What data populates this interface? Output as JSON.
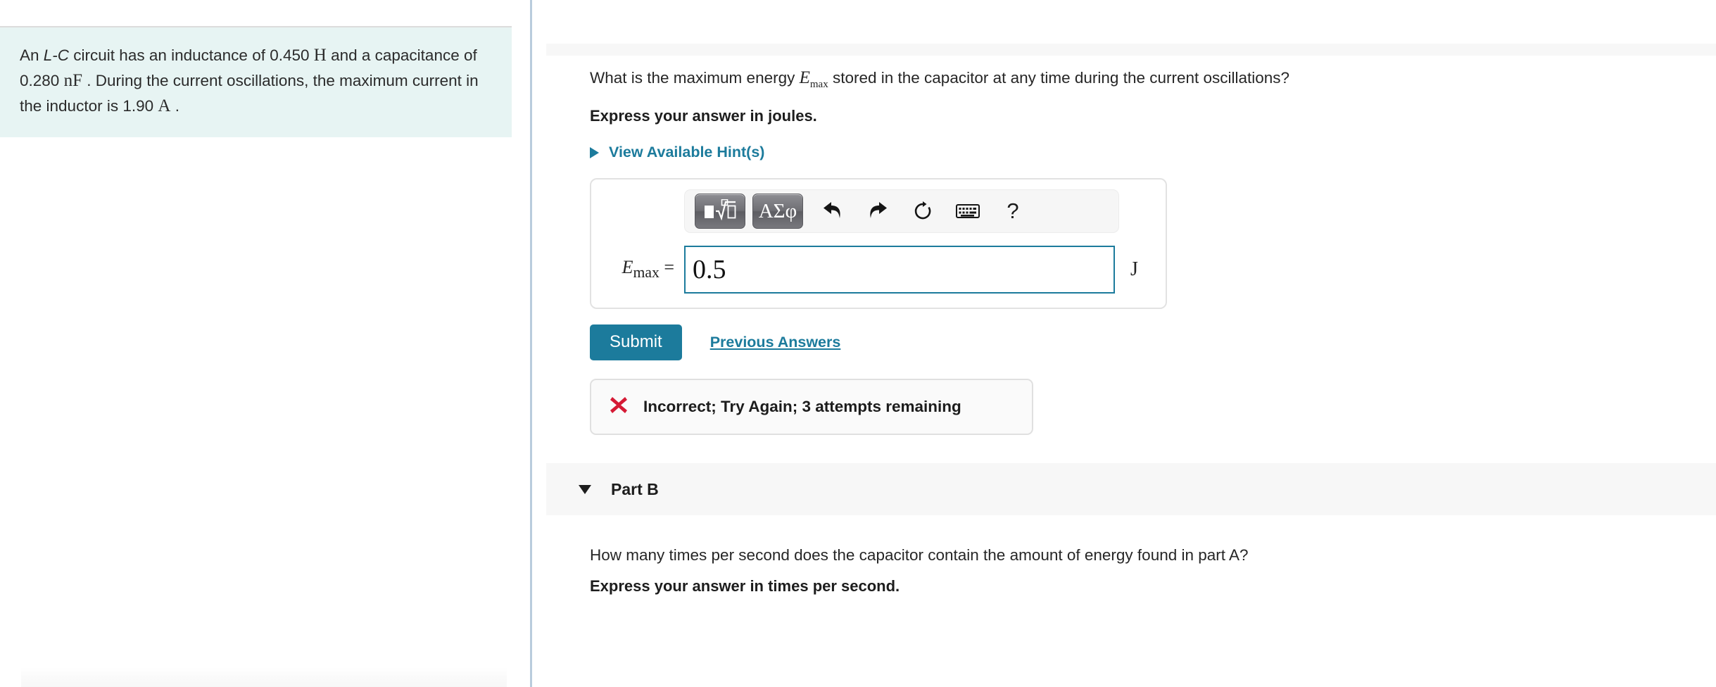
{
  "problem": {
    "prefix": "An ",
    "italic_term": "L-C",
    "line_part1": " circuit has an inductance of 0.450 ",
    "unit_henry": "H",
    "line_part2": " and a capacitance of 0.280 ",
    "unit_nanofarad": "nF",
    "line_part3": " . During the current oscillations, the maximum current in the inductor is 1.90 ",
    "unit_ampere": "A",
    "line_part4": " ."
  },
  "part_a": {
    "question_before_var": "What is the maximum energy ",
    "var_symbol": "E",
    "var_subscript": "max",
    "question_after_var": " stored in the capacitor at any time during the current oscillations?",
    "express_instruction": "Express your answer in joules.",
    "hints_label": "View Available Hint(s)",
    "hints_icon": "triangle-right-icon",
    "toolbar": {
      "math_template_button": "math-template-icon",
      "greek_button_label": "ΑΣφ",
      "undo_icon": "↰",
      "redo_icon": "↱",
      "reset_icon": "↻",
      "keyboard_icon": "⌨",
      "help_icon": "?"
    },
    "field": {
      "label_var": "E",
      "label_sub": "max",
      "label_equals": " =",
      "value": "0.5",
      "unit": "J"
    },
    "submit_label": "Submit",
    "previous_answers_label": "Previous Answers",
    "feedback": {
      "icon": "x-mark-icon",
      "text": "Incorrect; Try Again; 3 attempts remaining"
    }
  },
  "part_b": {
    "toggle_icon": "triangle-down-icon",
    "title": "Part B",
    "question": "How many times per second does the capacitor contain the amount of energy found in part A?",
    "express_instruction": "Express your answer in times per second."
  },
  "colors": {
    "accent_teal": "#1c7b9c",
    "problem_bg": "#e7f4f3",
    "error_red": "#d51a35",
    "band_gray": "#f7f7f7",
    "divider_blue": "#b9ccdd"
  }
}
